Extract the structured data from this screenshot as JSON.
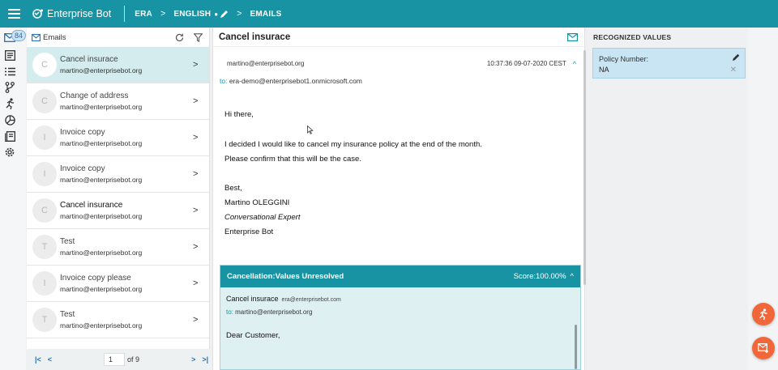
{
  "app": {
    "brand": "Enterprise Bot",
    "breadcrumbs": [
      "ERA",
      "ENGLISH",
      "EMAILS"
    ]
  },
  "rail": {
    "inbox_count": "84",
    "icons": [
      "mail-icon",
      "document-icon",
      "list-icon",
      "branch-icon",
      "runner-icon",
      "chart-icon",
      "book-icon",
      "settings-icon"
    ]
  },
  "email_list": {
    "header": "Emails",
    "items": [
      {
        "avatar": "C",
        "subject": "Cancel insurace",
        "from": "martino@enterprisebot.org",
        "selected": true,
        "bold": false
      },
      {
        "avatar": "C",
        "subject": "Change of address",
        "from": "martino@enterprisebot.org",
        "selected": false,
        "bold": false
      },
      {
        "avatar": "I",
        "subject": "Invoice copy",
        "from": "martino@enterprisebot.org",
        "selected": false,
        "bold": false
      },
      {
        "avatar": "I",
        "subject": "Invoice copy",
        "from": "martino@enterprisebot.org",
        "selected": false,
        "bold": false
      },
      {
        "avatar": "C",
        "subject": "Cancel insurance",
        "from": "martino@enterprisebot.org",
        "selected": false,
        "bold": true
      },
      {
        "avatar": "T",
        "subject": "Test",
        "from": "martino@enterprisebot.org",
        "selected": false,
        "bold": false
      },
      {
        "avatar": "I",
        "subject": "Invoice copy please",
        "from": "martino@enterprisebot.org",
        "selected": false,
        "bold": false
      },
      {
        "avatar": "T",
        "subject": "Test",
        "from": "martino@enterprisebot.org",
        "selected": false,
        "bold": false
      }
    ],
    "pager": {
      "page": "1",
      "of": "of 9"
    }
  },
  "email": {
    "title": "Cancel insurace",
    "from": "martino@enterprisebot.org",
    "timestamp": "10:37:36 09-07-2020 CEST",
    "to_label": "to:",
    "to": "era-demo@enterprisebot1.onmicrosoft.com",
    "body": [
      {
        "text": "Hi there,",
        "italic": false
      },
      {
        "text": "I decided I would like to cancel my insurance policy at the end of the month.",
        "italic": false
      },
      {
        "text": "Please confirm that this will be the case.",
        "italic": false
      },
      {
        "text": "Best,",
        "italic": false
      },
      {
        "text": "Martino OLEGGINI",
        "italic": false
      },
      {
        "text": "Conversational Expert",
        "italic": true
      },
      {
        "text": "Enterprise Bot",
        "italic": false
      }
    ]
  },
  "response": {
    "title": "Cancellation:Values Unresolved",
    "score": "Score:100.00%",
    "subject": "Cancel insurace",
    "from": "era@enterprisebot.com",
    "to_label": "to:",
    "to": "martino@enterprisebot.org",
    "greeting": "Dear Customer,"
  },
  "recognized": {
    "title": "RECOGNIZED VALUES",
    "label": "Policy Number:",
    "value": "NA"
  },
  "colors": {
    "accent": "#1893a4",
    "fab": "#f2673a",
    "selected": "#d4ecee"
  }
}
